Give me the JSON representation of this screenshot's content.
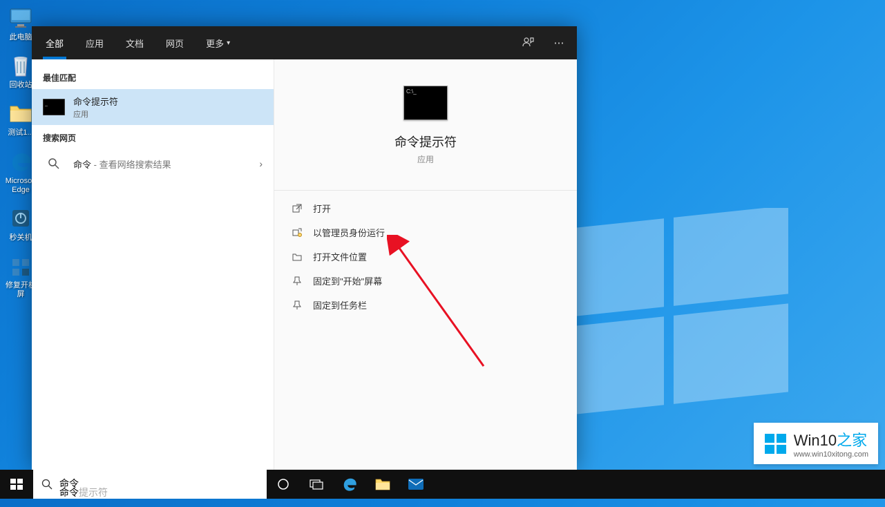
{
  "desktop": {
    "icons": [
      {
        "name": "this-pc",
        "label": "此电脑"
      },
      {
        "name": "recycle-bin",
        "label": "回收站"
      },
      {
        "name": "folder-test",
        "label": "测试1..."
      },
      {
        "name": "edge",
        "label": "Microsoft Edge"
      },
      {
        "name": "shutdown",
        "label": "秒关机"
      },
      {
        "name": "repair",
        "label": "修复开机 屏"
      }
    ]
  },
  "search_panel": {
    "tabs": {
      "all": "全部",
      "apps": "应用",
      "docs": "文档",
      "web": "网页",
      "more": "更多"
    },
    "sections": {
      "best_match": "最佳匹配",
      "web_search": "搜索网页"
    },
    "best_match": {
      "title": "命令提示符",
      "sub": "应用"
    },
    "web_item": {
      "query": "命令",
      "suffix": " - 查看网络搜索结果"
    },
    "preview": {
      "title": "命令提示符",
      "sub": "应用"
    },
    "actions": {
      "open": "打开",
      "run_admin": "以管理员身份运行",
      "open_location": "打开文件位置",
      "pin_start": "固定到\"开始\"屏幕",
      "pin_taskbar": "固定到任务栏"
    }
  },
  "taskbar": {
    "search_typed": "命令",
    "search_ghost": "提示符"
  },
  "watermark": {
    "brand": "Win10",
    "suffix_text": "之家",
    "url": "www.win10xitong.com"
  }
}
